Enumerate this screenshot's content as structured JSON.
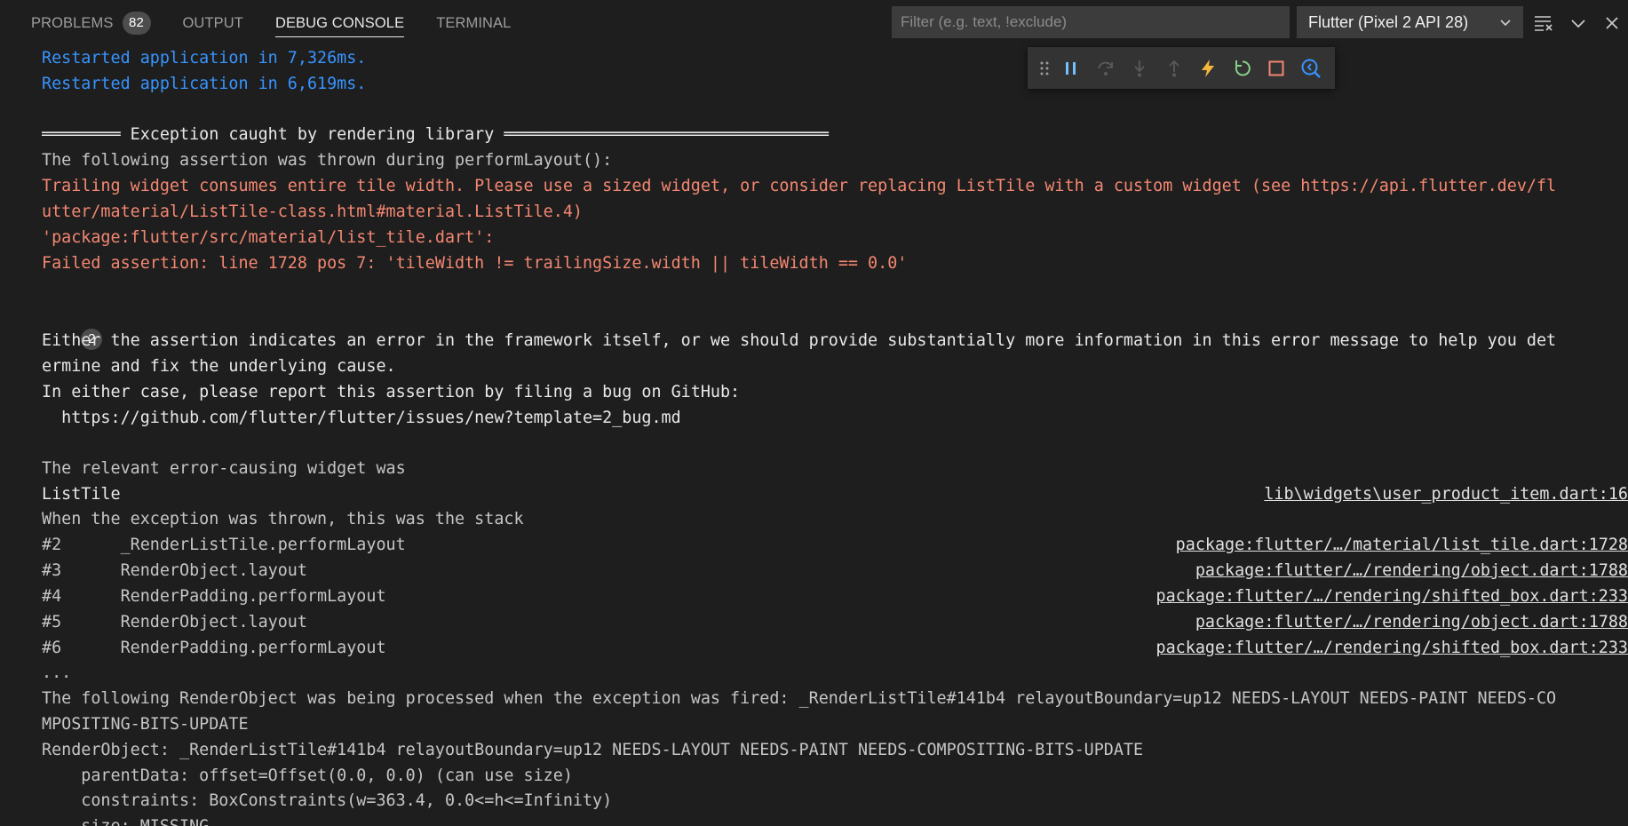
{
  "tabs": [
    {
      "label": "PROBLEMS",
      "badge": "82"
    },
    {
      "label": "OUTPUT"
    },
    {
      "label": "DEBUG CONSOLE"
    },
    {
      "label": "TERMINAL"
    }
  ],
  "filter": {
    "placeholder": "Filter (e.g. text, !exclude)"
  },
  "session": {
    "label": "Flutter (Pixel 2 API 28)"
  },
  "icons": {
    "header": [
      "clear-console-icon",
      "chevron-down-icon",
      "close-icon"
    ],
    "debug_toolbar": [
      "grip-icon",
      "pause-icon",
      "step-over-icon",
      "step-into-icon",
      "step-out-icon",
      "hot-reload-icon",
      "hot-restart-icon",
      "stop-icon",
      "inspect-widget-icon"
    ]
  },
  "colors": {
    "info": "#3794ff",
    "error": "#f48771",
    "reload": "#f5b83d",
    "restart": "#89d185"
  },
  "console": {
    "restart1": "Restarted application in 7,326ms.",
    "restart2": "Restarted application in 6,619ms.",
    "exception_header": "════════ Exception caught by rendering library ═════════════════════════════════",
    "assert_thrown": "The following assertion was thrown during performLayout():",
    "err1": "Trailing widget consumes entire tile width. Please use a sized widget, or consider replacing ListTile with a custom widget (see https://api.flutter.dev/fl",
    "err2": "utter/material/ListTile-class.html#material.ListTile.4)",
    "err3": "'package:flutter/src/material/list_tile.dart':",
    "err4": "Failed assertion: line 1728 pos 7: 'tileWidth != trailingSize.width || tileWidth == 0.0'",
    "group_count": "2",
    "either1": "Either the assertion indicates an error in the framework itself, or we should provide substantially more information in this error message to help you det",
    "either2": "ermine and fix the underlying cause.",
    "either3": "In either case, please report this assertion by filing a bug on GitHub:",
    "either4": "  https://github.com/flutter/flutter/issues/new?template=2_bug.md",
    "relevant": "The relevant error-causing widget was",
    "widget": "ListTile",
    "widget_link": "lib\\widgets\\user_product_item.dart:16",
    "stack_intro": "When the exception was thrown, this was the stack",
    "stack": [
      {
        "frame": "#2      _RenderListTile.performLayout",
        "link": "package:flutter/…/material/list_tile.dart:1728"
      },
      {
        "frame": "#3      RenderObject.layout",
        "link": "package:flutter/…/rendering/object.dart:1788"
      },
      {
        "frame": "#4      RenderPadding.performLayout",
        "link": "package:flutter/…/rendering/shifted_box.dart:233"
      },
      {
        "frame": "#5      RenderObject.layout",
        "link": "package:flutter/…/rendering/object.dart:1788"
      },
      {
        "frame": "#6      RenderPadding.performLayout",
        "link": "package:flutter/…/rendering/shifted_box.dart:233"
      }
    ],
    "ellipsis": "...",
    "processed1": "The following RenderObject was being processed when the exception was fired: _RenderListTile#141b4 relayoutBoundary=up12 NEEDS-LAYOUT NEEDS-PAINT NEEDS-CO",
    "processed2": "MPOSITING-BITS-UPDATE",
    "renderobj": "RenderObject: _RenderListTile#141b4 relayoutBoundary=up12 NEEDS-LAYOUT NEEDS-PAINT NEEDS-COMPOSITING-BITS-UPDATE",
    "parentdata": "    parentData: offset=Offset(0.0, 0.0) (can use size)",
    "constraints": "    constraints: BoxConstraints(w=363.4, 0.0<=h<=Infinity)",
    "size": "    size: MISSING"
  }
}
